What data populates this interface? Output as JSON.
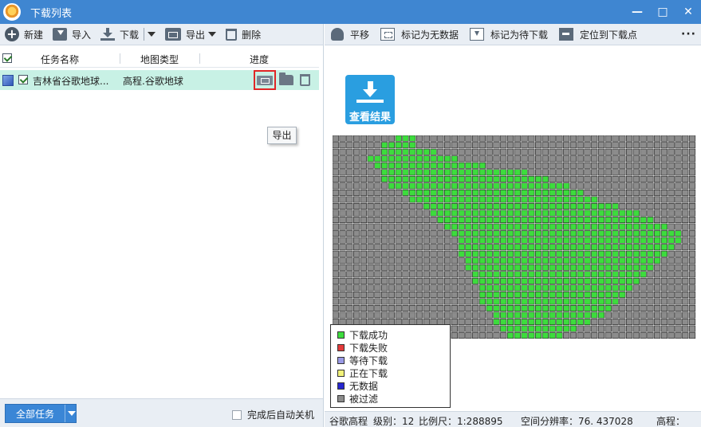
{
  "window": {
    "title": "下载列表",
    "controls": {
      "minimize": "—",
      "maximize": "□",
      "close": "✕"
    }
  },
  "left_toolbar": {
    "new": "新建",
    "import": "导入",
    "download": "下载",
    "export": "导出",
    "delete": "删除"
  },
  "list": {
    "headers": {
      "name": "任务名称",
      "map_type": "地图类型",
      "progress": "进度"
    },
    "rows": [
      {
        "name": "吉林省谷歌地球...",
        "map_type": "高程.谷歌地球"
      }
    ]
  },
  "tooltip": {
    "text": "导出"
  },
  "bottom": {
    "all_tasks": "全部任务",
    "auto_shutdown": "完成后自动关机"
  },
  "right_toolbar": {
    "pan": "平移",
    "mark_nodata": "标记为无数据",
    "mark_pending": "标记为待下载",
    "locate": "定位到下载点",
    "more": "···"
  },
  "view_result": {
    "label": "查看结果"
  },
  "tile_grid": {
    "cols": 52,
    "rows": 30,
    "colors": {
      "success": "#3ddc3d",
      "filtered": "#8c8c8c",
      "border": "#222222"
    },
    "success_mask": [
      "0000000001110000000000000000000000000000000000000000",
      "0000000111110000000000000000000000000000000000000000",
      "0000000111111110000000000000000000000000000000000000",
      "0000011111111111110000000000000000000000000000000000",
      "0000001111111111111111000000000000000000000000000000",
      "0000000111111111111111111111000000000000000000000000",
      "0000000111111111111111111111111000000000000000000000",
      "0000000011111111111111111111111111000000000000000000",
      "0000000000111111111111111111111111110000000000000000",
      "0000000000011111111111111111111111111100000000000000",
      "0000000000000111111111111111111111111111100000000000",
      "0000000000000011111111111111111111111111111100000000",
      "0000000000000001111111111111111111111111111111000000",
      "0000000000000000111111111111111111111111111111110000",
      "0000000000000000011111111111111111111111111111111100",
      "0000000000000000001111111111111111111111111111111100",
      "0000000000000000001111111111111111111111111111111000",
      "0000000000000000001111111111111111111111111111110000",
      "0000000000000000000111111111111111111111111111100000",
      "0000000000000000000111111111111111111111111111000000",
      "0000000000000000000011111111111111111111111110000000",
      "0000000000000000000011111111111111111111111100000000",
      "0000000000000000000001111111111111111111111000000000",
      "0000000000000000000001111111111111111111110000000000",
      "0000000000000000000001111111111111111111100000000000",
      "0000000000000000000000111111111111111111000000000000",
      "0000000000000000000000011111111111111110000000000000",
      "0000000000000000000000011111111111111000000000000000",
      "0000000000000000000000001111111111100000000000000000",
      "0000000000000000000000000111111110000000000000000000"
    ]
  },
  "legend": {
    "items": [
      {
        "label": "下载成功",
        "color": "#3ddc3d"
      },
      {
        "label": "下载失败",
        "color": "#e43a3a"
      },
      {
        "label": "等待下载",
        "color": "#9a9ae6"
      },
      {
        "label": "正在下载",
        "color": "#f2f27a"
      },
      {
        "label": "无数据",
        "color": "#2626d0"
      },
      {
        "label": "被过滤",
        "color": "#8c8c8c"
      }
    ]
  },
  "status": {
    "map": "谷歌高程",
    "level": "级别：12",
    "scale": "比例尺：1:288895",
    "resolution": "空间分辨率：76. 437028",
    "elevation": "高程："
  }
}
